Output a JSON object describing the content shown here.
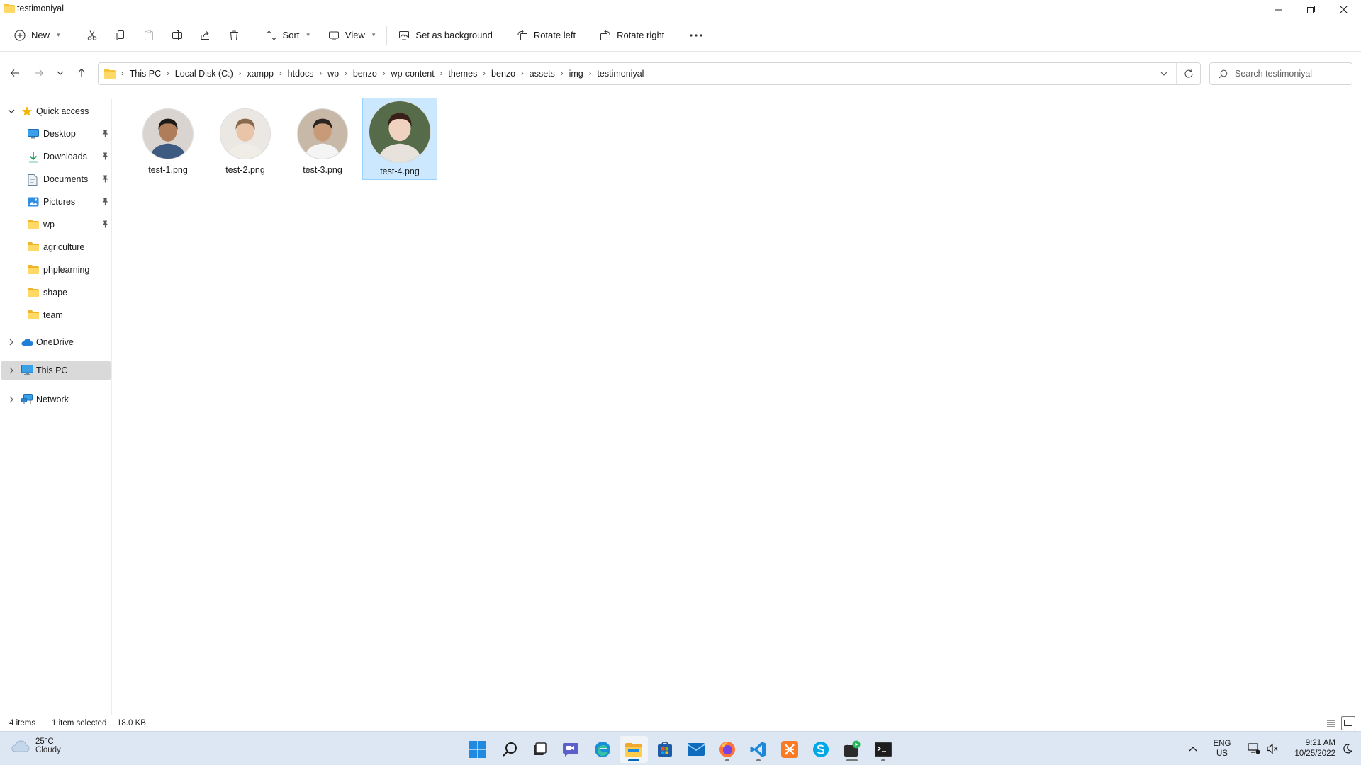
{
  "window": {
    "title": "testimoniyal"
  },
  "commandbar": {
    "new_label": "New",
    "sort_label": "Sort",
    "view_label": "View",
    "set_background_label": "Set as background",
    "rotate_left_label": "Rotate left",
    "rotate_right_label": "Rotate right"
  },
  "address": {
    "breadcrumbs": [
      "This PC",
      "Local Disk (C:)",
      "xampp",
      "htdocs",
      "wp",
      "benzo",
      "wp-content",
      "themes",
      "benzo",
      "assets",
      "img",
      "testimoniyal"
    ]
  },
  "search": {
    "placeholder": "Search testimoniyal"
  },
  "sidebar": {
    "quick_access": "Quick access",
    "quick_items": [
      {
        "label": "Desktop",
        "icon": "desktop-icon",
        "pinned": true
      },
      {
        "label": "Downloads",
        "icon": "download-icon",
        "pinned": true
      },
      {
        "label": "Documents",
        "icon": "documents-icon",
        "pinned": true
      },
      {
        "label": "Pictures",
        "icon": "pictures-icon",
        "pinned": true
      },
      {
        "label": "wp",
        "icon": "folder-icon",
        "pinned": true
      },
      {
        "label": "agriculture",
        "icon": "folder-icon",
        "pinned": false
      },
      {
        "label": "phplearning",
        "icon": "folder-icon",
        "pinned": false
      },
      {
        "label": "shape",
        "icon": "folder-icon",
        "pinned": false
      },
      {
        "label": "team",
        "icon": "folder-icon",
        "pinned": false
      }
    ],
    "onedrive": "OneDrive",
    "this_pc": "This PC",
    "network": "Network"
  },
  "files": [
    {
      "name": "test-1.png",
      "selected": false
    },
    {
      "name": "test-2.png",
      "selected": false
    },
    {
      "name": "test-3.png",
      "selected": false
    },
    {
      "name": "test-4.png",
      "selected": true
    }
  ],
  "status": {
    "item_count": "4 items",
    "selection": "1 item selected",
    "size": "18.0 KB"
  },
  "taskbar": {
    "weather_temp": "25°C",
    "weather_cond": "Cloudy",
    "lang": "ENG",
    "region": "US",
    "time": "9:21 AM",
    "date": "10/25/2022"
  },
  "colors": {
    "accent": "#0067c0",
    "selection_bg": "#cce8ff",
    "selection_border": "#99d1ff",
    "folder": "#f8c33a",
    "taskbar_bg": "#dde7f3"
  }
}
